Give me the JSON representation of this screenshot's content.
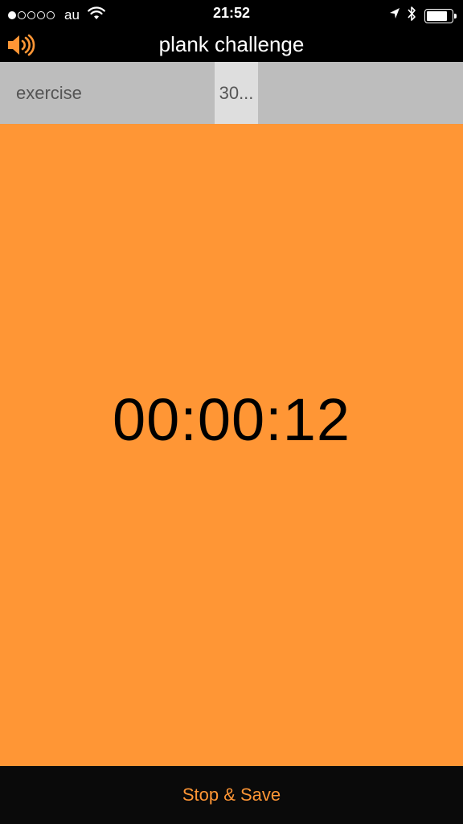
{
  "status_bar": {
    "signal_filled": 1,
    "signal_total": 5,
    "carrier": "au",
    "time": "21:52",
    "icons": [
      "wifi-icon",
      "location-arrow-icon",
      "bluetooth-icon",
      "battery-icon"
    ],
    "battery_level": 0.85
  },
  "nav": {
    "title": "plank challenge",
    "sound_icon": "speaker-volume-icon"
  },
  "tabs": {
    "exercise_label": "exercise",
    "duration_label": "30..."
  },
  "timer": {
    "value": "00:00:12"
  },
  "bottom": {
    "stop_save_label": "Stop & Save"
  },
  "colors": {
    "accent": "#ff9635",
    "tab_bg": "#bdbdbd",
    "tab_selected_bg": "#dedede",
    "bar_bg": "#000000",
    "bottom_bg": "#0a0a0a"
  }
}
